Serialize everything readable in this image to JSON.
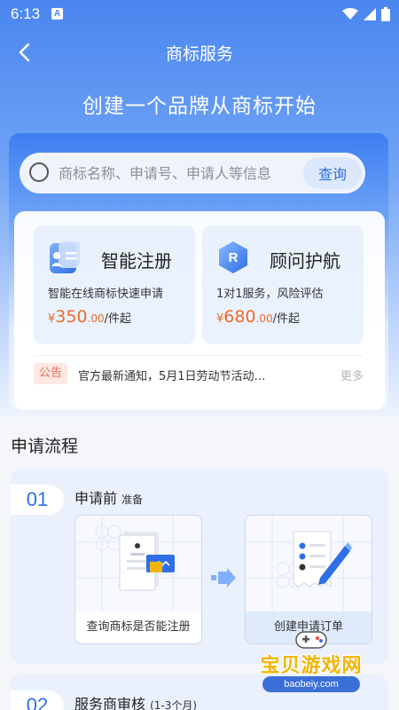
{
  "status_bar": {
    "time": "6:13",
    "notification_letter": "A"
  },
  "nav": {
    "title": "商标服务"
  },
  "slogan": "创建一个品牌从商标开始",
  "search": {
    "placeholder": "商标名称、申请号、申请人等信息",
    "button_label": "查询"
  },
  "services": [
    {
      "icon": "id-card-icon",
      "title": "智能注册",
      "description": "智能在线商标快速申请",
      "price_symbol": "¥",
      "price_int": "350",
      "price_dec": ".00",
      "price_unit": "/件起"
    },
    {
      "icon": "r-badge-icon",
      "title": "顾问护航",
      "description": "1对1服务，风险评估",
      "price_symbol": "¥",
      "price_int": "680",
      "price_dec": ".00",
      "price_unit": "/件起"
    }
  ],
  "notice": {
    "tag": "公告",
    "text": "官方最新通知，5月1日劳动节活动…",
    "more": "更多"
  },
  "process": {
    "section_title": "申请流程",
    "steps": [
      {
        "number": "01",
        "title": "申请前",
        "subtitle": "准备",
        "items": [
          "查询商标是否能注册",
          "创建申请订单"
        ]
      },
      {
        "number": "02",
        "title": "服务商审核",
        "subtitle": "(1-3个月)"
      }
    ]
  },
  "watermark": {
    "text": "宝贝游戏网",
    "url": "baobeiy.com"
  },
  "colors": {
    "primary": "#2e6fe6",
    "price": "#f06a2a",
    "notice_tag": "#ef6b50",
    "watermark": "#f4b400"
  }
}
